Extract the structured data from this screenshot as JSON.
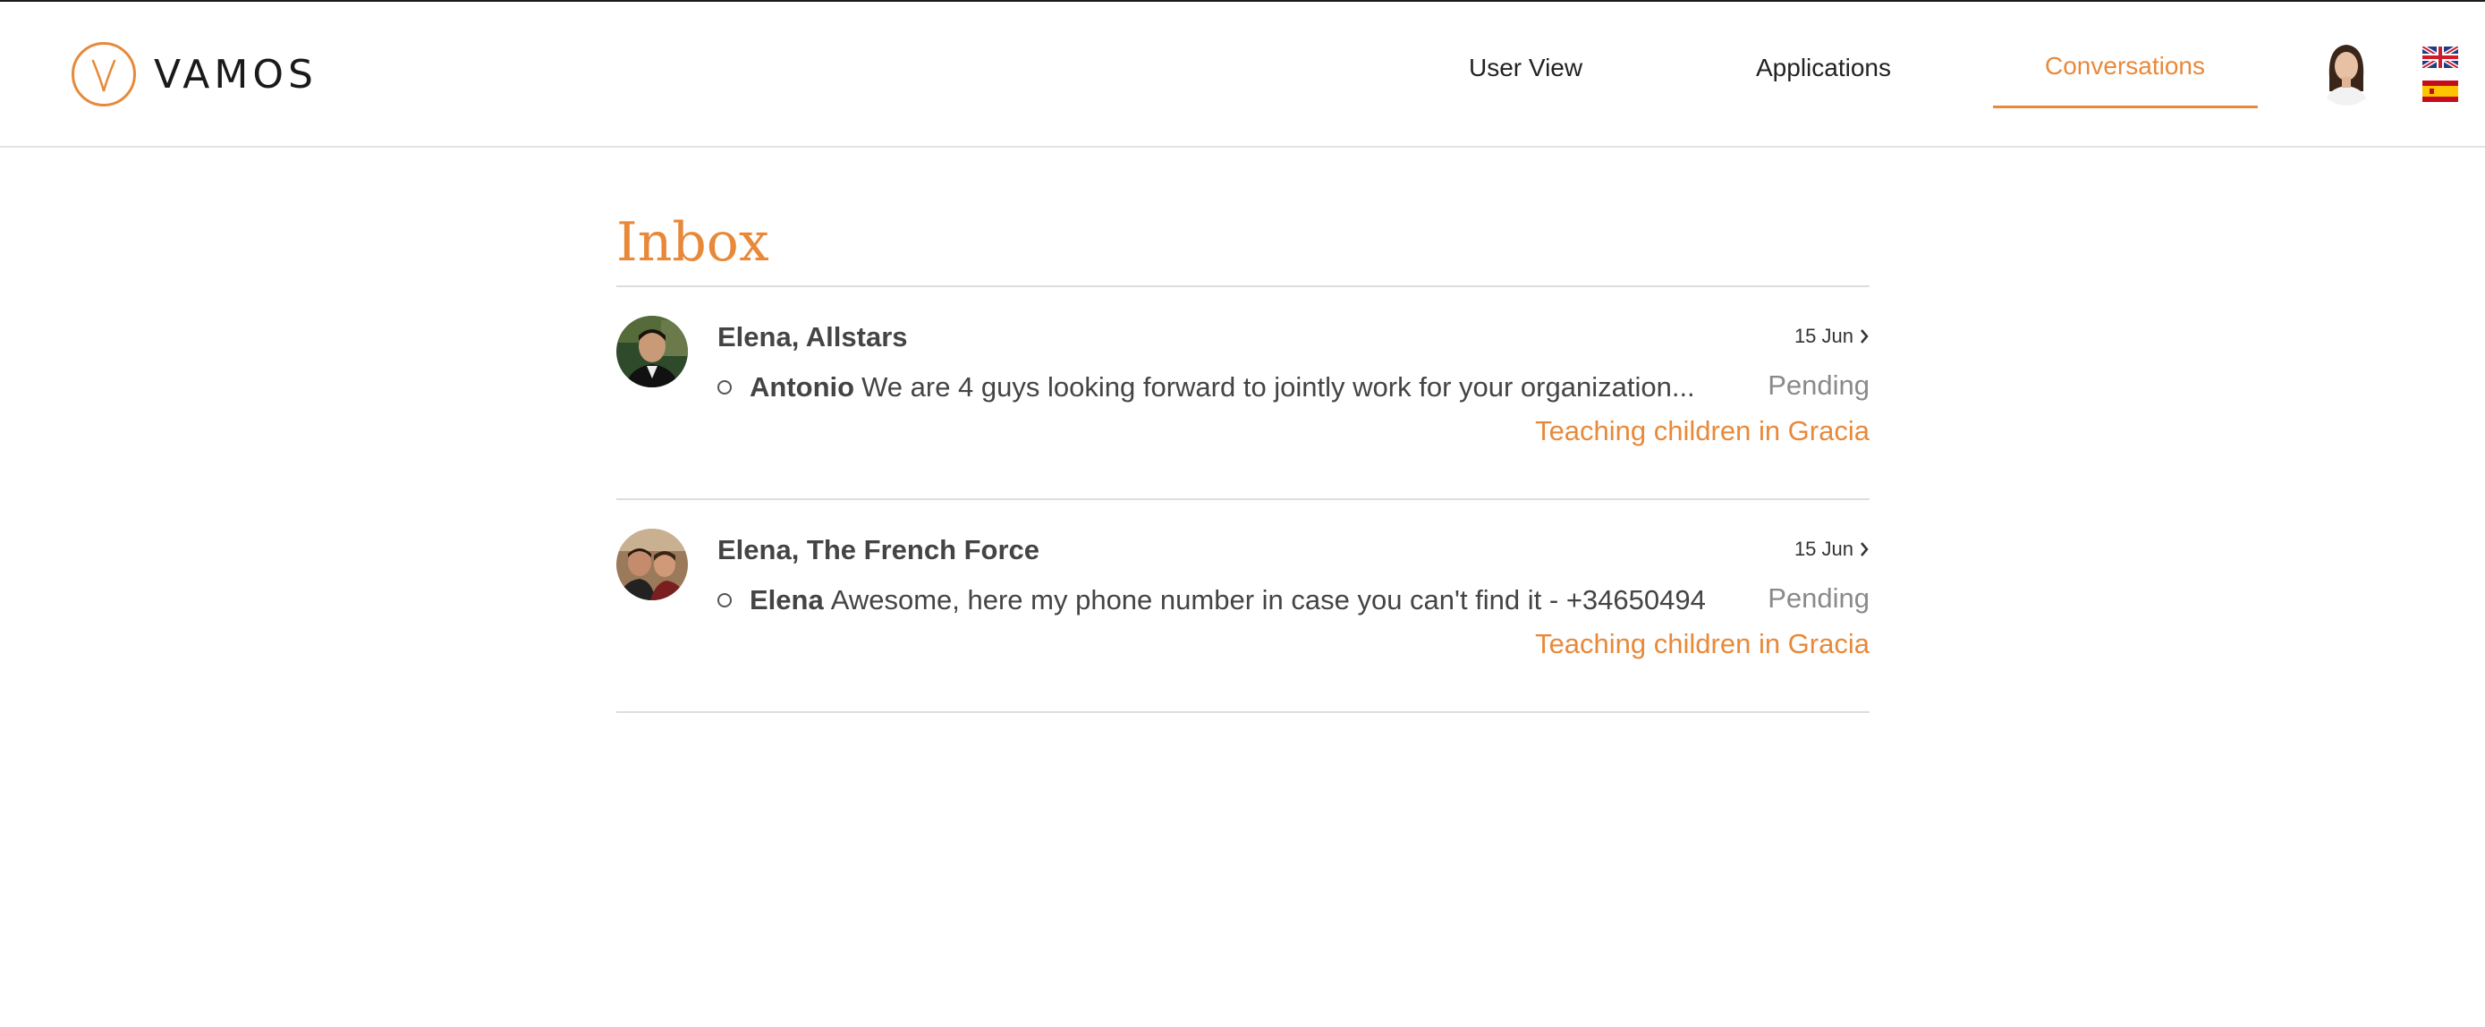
{
  "brand": {
    "name": "VAMOS",
    "accent": "#e8893a",
    "logo_icon": "v-logo-icon"
  },
  "nav": {
    "items": [
      {
        "label": "User View",
        "active": false
      },
      {
        "label": "Applications",
        "active": false
      },
      {
        "label": "Conversations",
        "active": true
      }
    ]
  },
  "languages": [
    {
      "icon": "uk-flag-icon"
    },
    {
      "icon": "spain-flag-icon"
    }
  ],
  "inbox": {
    "title": "Inbox",
    "conversations": [
      {
        "title": "Elena, Allstars",
        "date": "15 Jun",
        "sender": "Antonio",
        "snippet": "We are 4 guys looking forward to jointly work for your organization...",
        "status": "Pending",
        "project": "Teaching children in Gracia"
      },
      {
        "title": "Elena, The French Force",
        "date": "15 Jun",
        "sender": "Elena",
        "snippet": "Awesome, here my phone number in case you can't find it - +34650494",
        "status": "Pending",
        "project": "Teaching children in Gracia"
      }
    ]
  }
}
